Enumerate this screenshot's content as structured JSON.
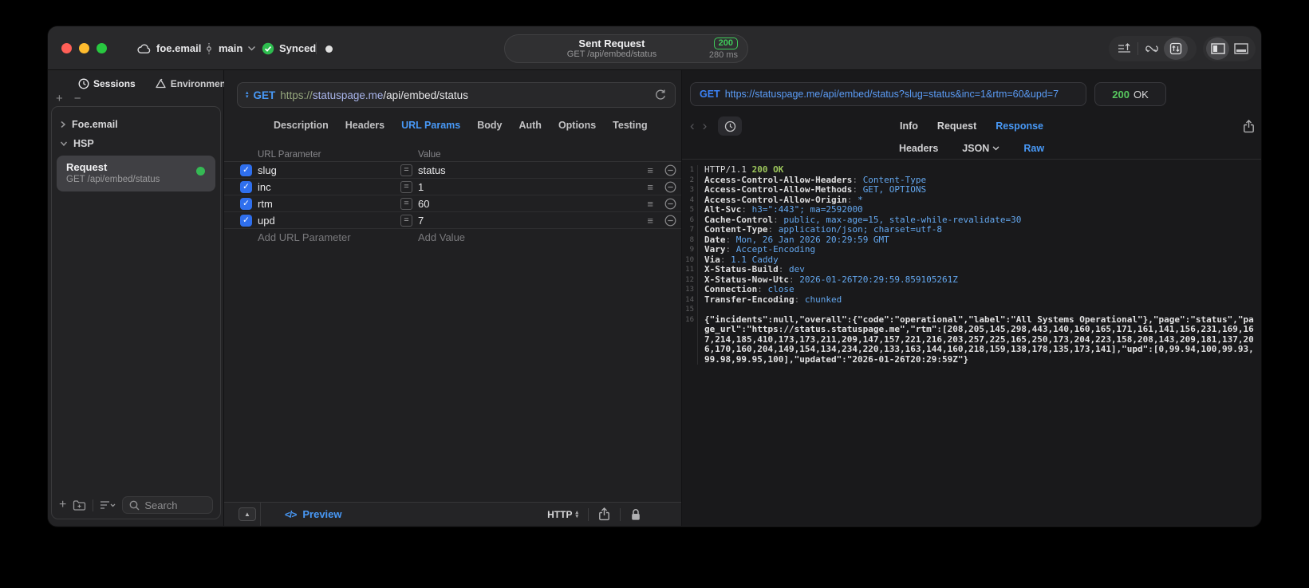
{
  "titlebar": {
    "account": "foe.email",
    "branch": "main",
    "sync_label": "Synced",
    "center": {
      "title": "Sent Request",
      "subtitle": "GET /api/embed/status",
      "status_code": "200",
      "duration": "280 ms"
    }
  },
  "sidebar": {
    "tabs": [
      {
        "label": "Sessions"
      },
      {
        "label": "Environments"
      }
    ],
    "tree": [
      {
        "label": "Foe.email"
      },
      {
        "label": "HSP"
      }
    ],
    "request_item": {
      "title": "Request",
      "subtitle": "GET /api/embed/status"
    },
    "search_placeholder": "Search"
  },
  "request": {
    "method": "GET",
    "url_scheme": "https://",
    "url_host": "statuspage.me",
    "url_path": "/api/embed/status",
    "tabs": [
      "Description",
      "Headers",
      "URL Params",
      "Body",
      "Auth",
      "Options",
      "Testing"
    ],
    "active_tab": "URL Params",
    "params": {
      "col_param": "URL Parameter",
      "col_value": "Value",
      "equals_symbol": "=",
      "rows": [
        {
          "name": "slug",
          "value": "status",
          "checked": true
        },
        {
          "name": "inc",
          "value": "1",
          "checked": true
        },
        {
          "name": "rtm",
          "value": "60",
          "checked": true
        },
        {
          "name": "upd",
          "value": "7",
          "checked": true
        }
      ],
      "add_param_placeholder": "Add URL Parameter",
      "add_value_placeholder": "Add Value"
    },
    "footer": {
      "preview_icon": "</>",
      "preview_label": "Preview",
      "protocol_label": "HTTP"
    }
  },
  "response": {
    "request_method": "GET",
    "request_url": "https://statuspage.me/api/embed/status?slug=status&inc=1&rtm=60&upd=7",
    "status_code": "200",
    "status_text": "OK",
    "tabs": [
      "Info",
      "Request",
      "Response"
    ],
    "active_tab": "Response",
    "subtabs": [
      "Headers",
      "JSON",
      "Raw"
    ],
    "active_subtab": "Raw",
    "status_line": {
      "protocol": "HTTP/1.1",
      "status": "200 OK"
    },
    "headers": [
      {
        "name": "Access-Control-Allow-Headers",
        "value": "Content-Type"
      },
      {
        "name": "Access-Control-Allow-Methods",
        "value": "GET, OPTIONS"
      },
      {
        "name": "Access-Control-Allow-Origin",
        "value": "*"
      },
      {
        "name": "Alt-Svc",
        "value": "h3=\":443\"; ma=2592000"
      },
      {
        "name": "Cache-Control",
        "value": "public, max-age=15, stale-while-revalidate=30"
      },
      {
        "name": "Content-Type",
        "value": "application/json; charset=utf-8"
      },
      {
        "name": "Date",
        "value": "Mon, 26 Jan 2026 20:29:59 GMT"
      },
      {
        "name": "Vary",
        "value": "Accept-Encoding"
      },
      {
        "name": "Via",
        "value": "1.1 Caddy"
      },
      {
        "name": "X-Status-Build",
        "value": "dev"
      },
      {
        "name": "X-Status-Now-Utc",
        "value": "2026-01-26T20:29:59.859105261Z"
      },
      {
        "name": "Connection",
        "value": "close"
      },
      {
        "name": "Transfer-Encoding",
        "value": "chunked"
      }
    ],
    "body": "{\"incidents\":null,\"overall\":{\"code\":\"operational\",\"label\":\"All Systems Operational\"},\"page\":\"status\",\"page_url\":\"https://status.statuspage.me\",\"rtm\":[208,205,145,298,443,140,160,165,171,161,141,156,231,169,167,214,185,410,173,173,211,209,147,157,221,216,203,257,225,165,250,173,204,223,158,208,143,209,181,137,206,170,160,204,149,154,134,234,220,133,163,144,160,218,159,138,178,135,173,141],\"upd\":[0,99.94,100,99.93,99.98,99.95,100],\"updated\":\"2026-01-26T20:29:59Z\"}"
  },
  "colors": {
    "accent_blue": "#4899f7",
    "status_green": "#3fcb5a",
    "checkbox_blue": "#2f6fed",
    "traffic_red": "#ff5f57",
    "traffic_yellow": "#febc2e",
    "traffic_green": "#28c840"
  }
}
